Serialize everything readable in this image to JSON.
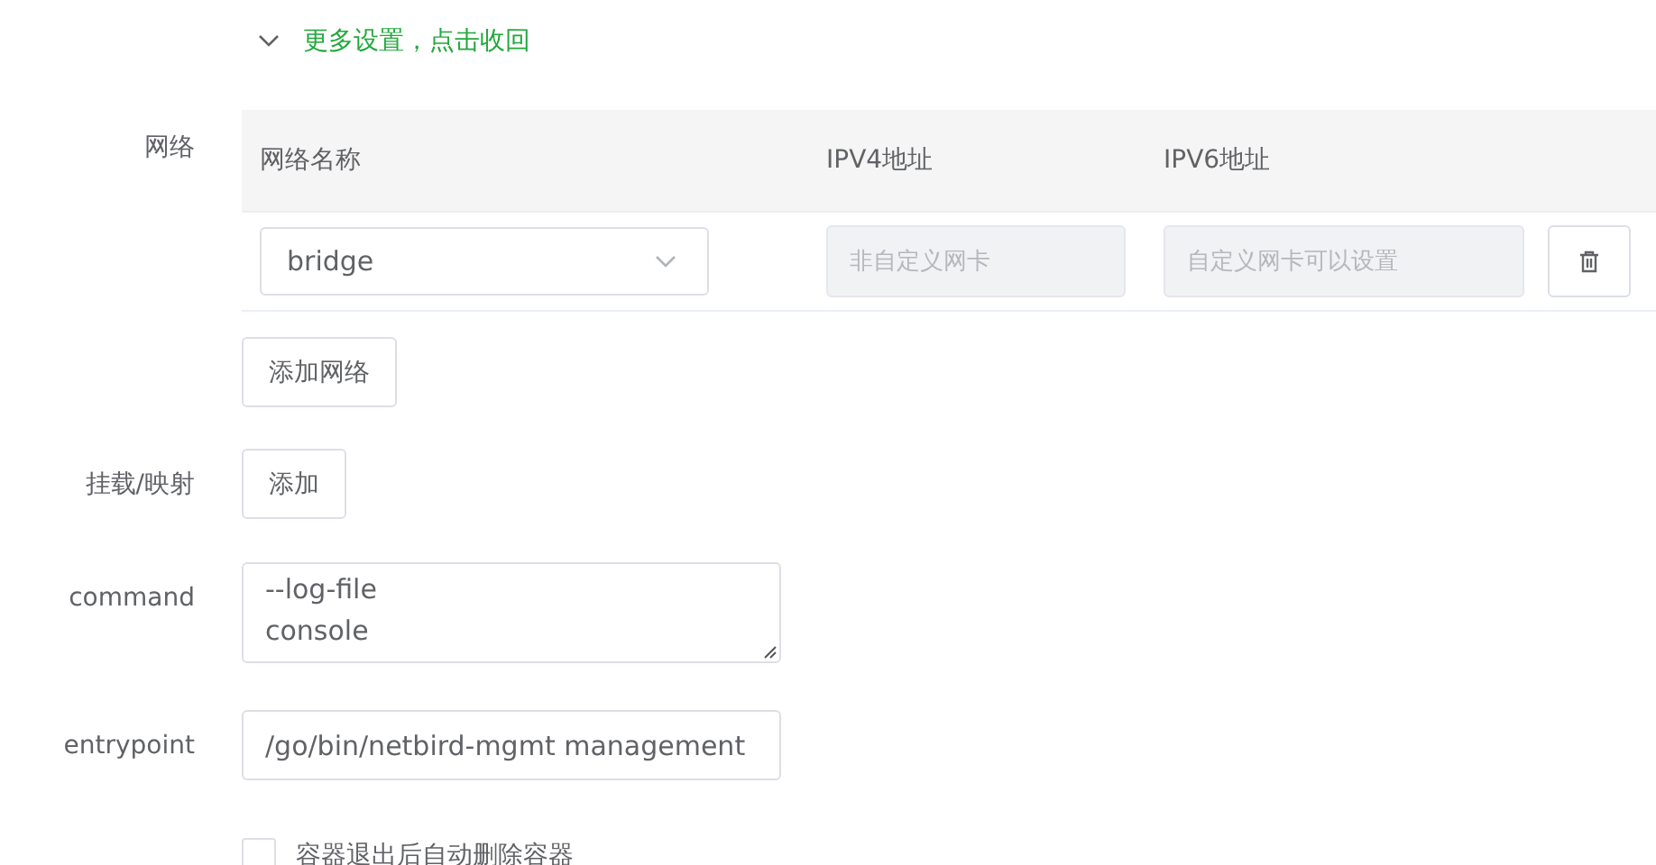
{
  "collapse": {
    "label": "更多设置，点击收回",
    "expanded": true
  },
  "network": {
    "label": "网络",
    "columns": [
      "网络名称",
      "IPV4地址",
      "IPV6地址"
    ],
    "rows": [
      {
        "network": "bridge",
        "ipv4": {
          "placeholder": "非自定义网卡",
          "disabled": true
        },
        "ipv6": {
          "placeholder": "自定义网卡可以设置",
          "disabled": true
        }
      }
    ],
    "add_button": "添加网络"
  },
  "mounts": {
    "label": "挂载/映射",
    "add_button": "添加"
  },
  "command": {
    "label": "command",
    "value": "--log-file\nconsole"
  },
  "entrypoint": {
    "label": "entrypoint",
    "value": "/go/bin/netbird-mgmt management"
  },
  "auto_remove": {
    "label": "容器退出后自动删除容器",
    "checked": false
  }
}
